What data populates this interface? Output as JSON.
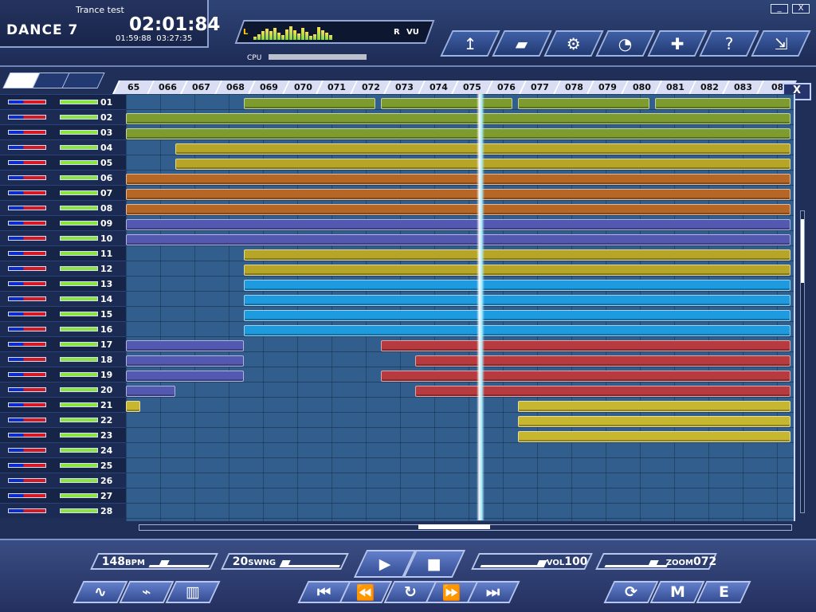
{
  "header": {
    "song_title": "Trance test",
    "logo": "DANCE 7",
    "time_main": "02:01:84",
    "time_elapsed": "01:59:88",
    "time_total": "03:27:35",
    "vu_left": "L",
    "vu_right": "R",
    "vu_label": "VU",
    "cpu_label": "CPU",
    "cpu_percent": 14
  },
  "toolbar": [
    "upload-icon",
    "folder-icon",
    "drum-icon",
    "speaker-icon",
    "puzzle-icon",
    "help-icon",
    "minimize-window-icon"
  ],
  "window_controls": [
    "_",
    "X"
  ],
  "mode_tabs": [
    "pencil-mode",
    "wave-mode",
    "envelope-mode"
  ],
  "timeline": {
    "measures": [
      "65",
      "066",
      "067",
      "068",
      "069",
      "070",
      "071",
      "072",
      "073",
      "074",
      "075",
      "076",
      "077",
      "078",
      "079",
      "080",
      "081",
      "082",
      "083",
      "08"
    ],
    "x_button": "X"
  },
  "tracks": [
    "01",
    "02",
    "03",
    "04",
    "05",
    "06",
    "07",
    "08",
    "09",
    "10",
    "11",
    "12",
    "13",
    "14",
    "15",
    "16",
    "17",
    "18",
    "19",
    "20",
    "21",
    "22",
    "23",
    "24",
    "25",
    "26",
    "27",
    "28"
  ],
  "bottom": {
    "bpm": "148",
    "bpm_unit": "BPM",
    "swing": "20",
    "swing_unit": "SWNG",
    "vol_label": "VOL",
    "vol": "100",
    "zoom_label": "ZOOM",
    "zoom": "072"
  },
  "transport": [
    "play",
    "stop",
    "rewind",
    "fast-rewind",
    "loop",
    "fast-forward",
    "forward"
  ],
  "tools": [
    "wave-tool",
    "envelope-tool",
    "pattern-tool",
    "refresh-tool",
    "midi-tool",
    "edit-tool"
  ]
}
